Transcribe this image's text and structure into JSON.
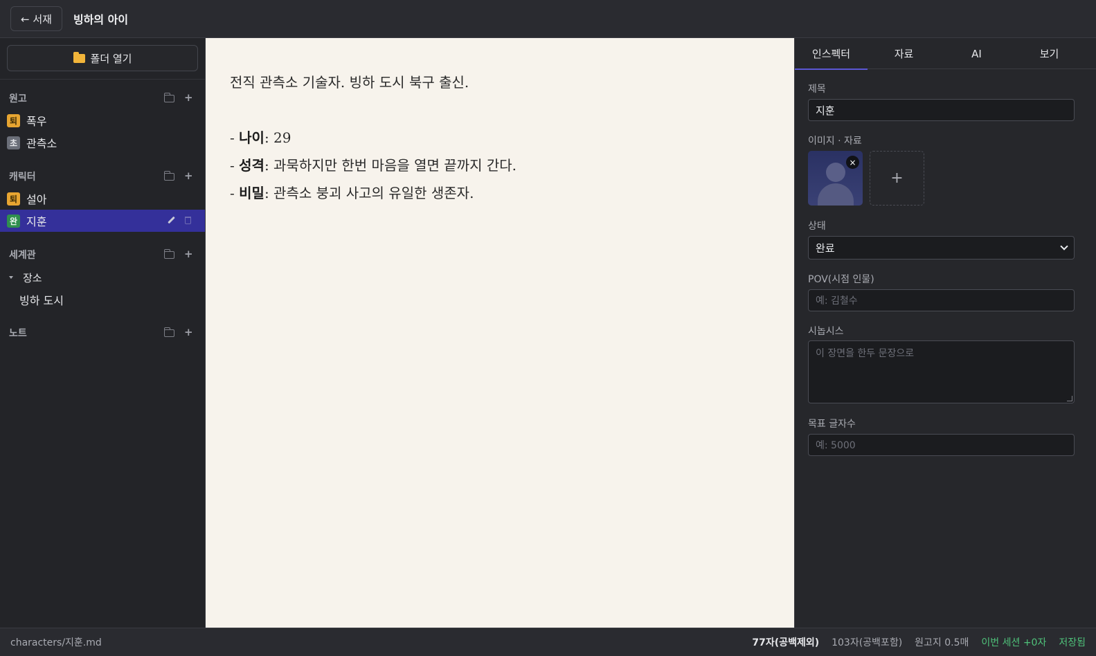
{
  "topbar": {
    "back_label": "← 서재",
    "book_title": "빙하의 아이"
  },
  "sidebar": {
    "open_folder_label": "폴더 열기",
    "sections": {
      "manuscript": {
        "title": "원고",
        "items": [
          {
            "badge": "퇴",
            "label": "폭우"
          },
          {
            "badge": "초",
            "label": "관측소"
          }
        ]
      },
      "characters": {
        "title": "캐릭터",
        "items": [
          {
            "badge": "퇴",
            "label": "설아"
          },
          {
            "badge": "완",
            "label": "지훈"
          }
        ]
      },
      "world": {
        "title": "세계관",
        "group": "장소",
        "items": [
          {
            "label": "빙하 도시"
          }
        ]
      },
      "notes": {
        "title": "노트"
      }
    },
    "active_item": "지훈"
  },
  "editor": {
    "intro": "전직 관측소 기술자. 빙하 도시 북구 출신.",
    "lines": [
      {
        "prefix": "- ",
        "key": "나이",
        "value": ": 29"
      },
      {
        "prefix": "- ",
        "key": "성격",
        "value": ": 과묵하지만 한번 마음을 열면 끝까지 간다."
      },
      {
        "prefix": "- ",
        "key": "비밀",
        "value": ": 관측소 붕괴 사고의 유일한 생존자."
      }
    ]
  },
  "inspector": {
    "tabs": [
      "인스펙터",
      "자료",
      "AI",
      "보기"
    ],
    "active_tab": "인스펙터",
    "title_label": "제목",
    "title_value": "지훈",
    "images_label": "이미지 · 자료",
    "close_glyph": "×",
    "add_glyph": "+",
    "status_label": "상태",
    "status_value": "완료",
    "pov_label": "POV(시점 인물)",
    "pov_placeholder": "예: 김철수",
    "synopsis_label": "시놉시스",
    "synopsis_placeholder": "이 장면을 한두 문장으로",
    "target_label": "목표 글자수",
    "target_placeholder": "예: 5000"
  },
  "statusbar": {
    "path": "characters/지훈.md",
    "chars_no_space": "77자(공백제외)",
    "chars_with_space": "103자(공백포함)",
    "manuscript_pages": "원고지 0.5매",
    "session": "이번 세션 +0자",
    "saved": "저장됨"
  },
  "colors": {
    "accent": "#5c57d6",
    "active_row": "#34309a",
    "saved_green": "#4fc27a",
    "editor_bg": "#f7f3ec"
  },
  "icons": [
    "folder-icon",
    "folder-outline-icon",
    "plus-icon",
    "pencil-icon",
    "trash-icon",
    "caret-down-icon",
    "close-icon",
    "chevron-down-icon",
    "avatar-image"
  ]
}
